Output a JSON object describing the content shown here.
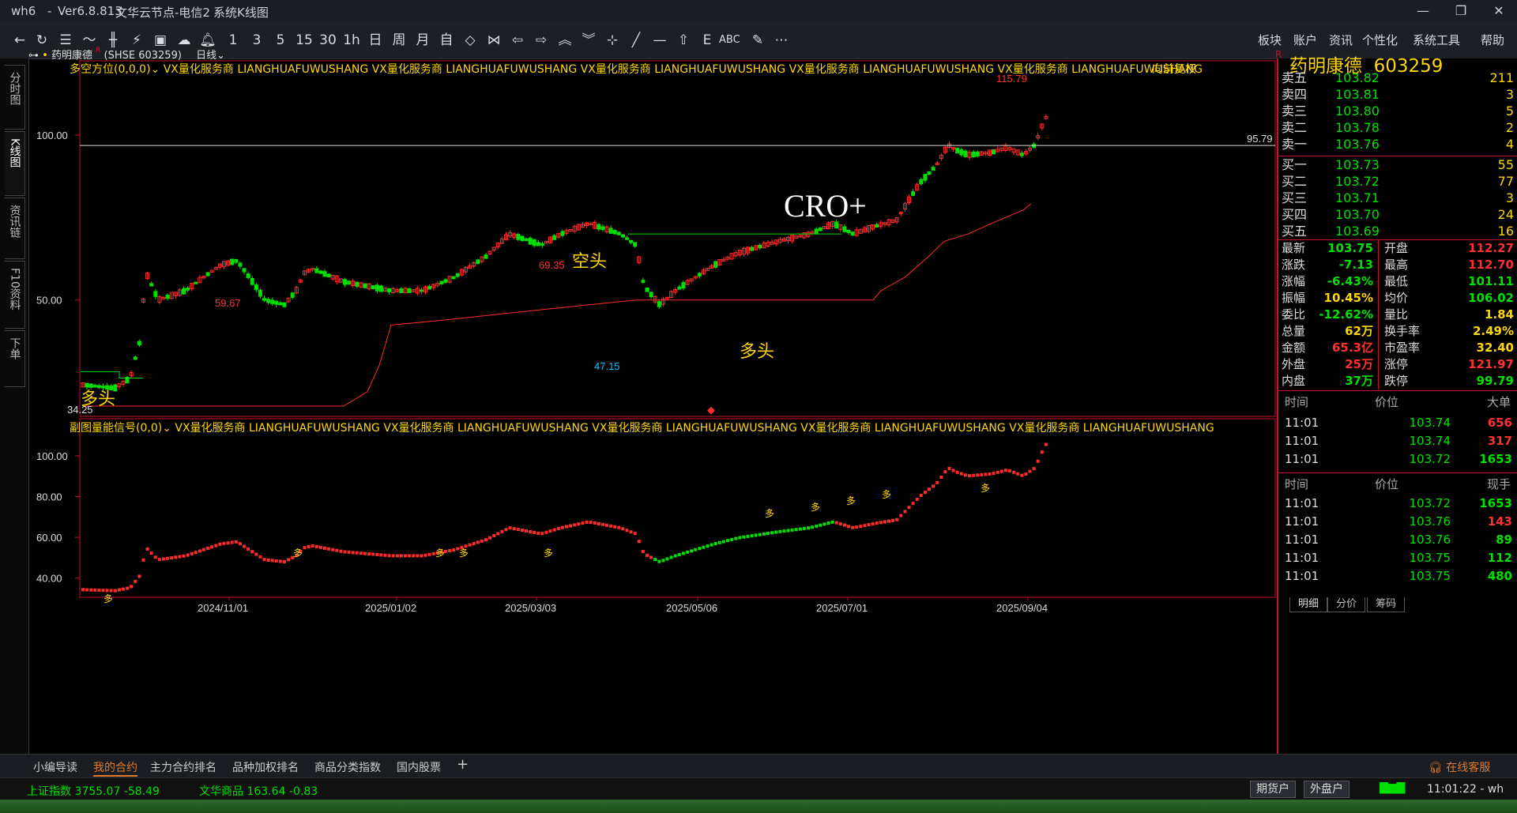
{
  "titlebar": {
    "app": "wh6",
    "version": "Ver6.8.813",
    "node": "文华云节点-电信2",
    "view": "系统K线图"
  },
  "menu_right": [
    "板块",
    "账户",
    "资讯",
    "个性化",
    "系统工具",
    "帮助"
  ],
  "toolbar_periods": [
    "1",
    "3",
    "5",
    "15",
    "30",
    "1h",
    "日",
    "周",
    "月",
    "自"
  ],
  "left_tabs": [
    "分时图",
    "K线图",
    "资讯链",
    "F10资料",
    "下单"
  ],
  "chart_header": {
    "symbol_name": "药明康德",
    "symbol_code": "(SHSE 603259)",
    "period": "日线",
    "main_indicator": "多空方位(0,0,0)",
    "main_ads": "VX量化服务商  LIANGHUAFUWUSHANG  VX量化服务商  LIANGHUAFUWUSHANG  VX量化服务商  LIANGHUAFUWUSHANG  VX量化服务商  LIANGHUAFUWUSHANG  VX量化服务商  LIANGHUAFUWUSHANG",
    "adjust": "向前复权",
    "sub_indicator": "副图量能信号(0,0)",
    "sub_ads": "VX量化服务商  LIANGHUAFUWUSHANG  VX量化服务商  LIANGHUAFUWUSHANG  VX量化服务商  LIANGHUAFUWUSHANG  VX量化服务商  LIANGHUAFUWUSHANG  VX量化服务商  LIANGHUAFUWUSHANG"
  },
  "annotations": {
    "high": "115.79",
    "ref_line": "95.79",
    "p1": "59.67",
    "p2": "69.35",
    "low": "47.15",
    "start": "34.25",
    "kongtou": "空头",
    "duotou1": "多头",
    "duotou2": "多头",
    "cro": "CRO+"
  },
  "axis": {
    "main_ticks": [
      "100.00",
      "50.00"
    ],
    "sub_ticks": [
      "100.00",
      "80.00",
      "60.00",
      "40.00"
    ],
    "dates": [
      "2024/11/01",
      "2025/01/02",
      "2025/03/03",
      "2025/05/06",
      "2025/07/01",
      "2025/09/04"
    ]
  },
  "colors": {
    "up": "#ff2a2a",
    "down": "#00e000",
    "accent": "#c8102e",
    "gold": "#ffd700"
  },
  "quote": {
    "name": "药明康德",
    "code": "603259",
    "asks": [
      {
        "label": "卖五",
        "price": "103.82",
        "vol": "211"
      },
      {
        "label": "卖四",
        "price": "103.81",
        "vol": "3"
      },
      {
        "label": "卖三",
        "price": "103.80",
        "vol": "5"
      },
      {
        "label": "卖二",
        "price": "103.78",
        "vol": "2"
      },
      {
        "label": "卖一",
        "price": "103.76",
        "vol": "4"
      }
    ],
    "bids": [
      {
        "label": "买一",
        "price": "103.73",
        "vol": "55"
      },
      {
        "label": "买二",
        "price": "103.72",
        "vol": "77"
      },
      {
        "label": "买三",
        "price": "103.71",
        "vol": "3"
      },
      {
        "label": "买四",
        "price": "103.70",
        "vol": "24"
      },
      {
        "label": "买五",
        "price": "103.69",
        "vol": "16"
      }
    ],
    "stats": [
      {
        "l1": "最新",
        "v1": "103.75",
        "c1": "g",
        "l2": "开盘",
        "v2": "112.27",
        "c2": "r"
      },
      {
        "l1": "涨跌",
        "v1": "-7.13",
        "c1": "g",
        "l2": "最高",
        "v2": "112.70",
        "c2": "r"
      },
      {
        "l1": "涨幅",
        "v1": "-6.43%",
        "c1": "g",
        "l2": "最低",
        "v2": "101.11",
        "c2": "g"
      },
      {
        "l1": "振幅",
        "v1": "10.45%",
        "c1": "y",
        "l2": "均价",
        "v2": "106.02",
        "c2": "g"
      },
      {
        "l1": "委比",
        "v1": "-12.62%",
        "c1": "g",
        "l2": "量比",
        "v2": "1.84",
        "c2": "y"
      },
      {
        "l1": "总量",
        "v1": "62万",
        "c1": "y",
        "l2": "换手率",
        "v2": "2.49%",
        "c2": "y"
      },
      {
        "l1": "金额",
        "v1": "65.3亿",
        "c1": "r",
        "l2": "市盈率",
        "v2": "32.40",
        "c2": "y"
      },
      {
        "l1": "外盘",
        "v1": "25万",
        "c1": "r",
        "l2": "涨停",
        "v2": "121.97",
        "c2": "r"
      },
      {
        "l1": "内盘",
        "v1": "37万",
        "c1": "g",
        "l2": "跌停",
        "v2": "99.79",
        "c2": "g"
      }
    ],
    "ticks1_header": {
      "time": "时间",
      "price": "价位",
      "vol": "大单"
    },
    "ticks1": [
      {
        "time": "11:01",
        "price": "103.74",
        "vol": "656",
        "c": "r"
      },
      {
        "time": "11:01",
        "price": "103.74",
        "vol": "317",
        "c": "r"
      },
      {
        "time": "11:01",
        "price": "103.72",
        "vol": "1653",
        "c": "g"
      }
    ],
    "ticks2_header": {
      "time": "时间",
      "price": "价位",
      "vol": "现手"
    },
    "ticks2": [
      {
        "time": "11:01",
        "price": "103.72",
        "vol": "1653",
        "c": "g"
      },
      {
        "time": "11:01",
        "price": "103.76",
        "vol": "143",
        "c": "r"
      },
      {
        "time": "11:01",
        "price": "103.76",
        "vol": "89",
        "c": "g"
      },
      {
        "time": "11:01",
        "price": "103.75",
        "vol": "112",
        "c": "g"
      },
      {
        "time": "11:01",
        "price": "103.75",
        "vol": "480",
        "c": "g"
      }
    ],
    "panel_tabs": [
      "明细",
      "分价",
      "筹码"
    ]
  },
  "bottom_tabs": [
    "小编导读",
    "我的合约",
    "主力合约排名",
    "品种加权排名",
    "商品分类指数",
    "国内股票",
    "+"
  ],
  "online_service": "在线客服",
  "status": {
    "idx1_name": "上证指数",
    "idx1_val": "3755.07",
    "idx1_chg": "-58.49",
    "idx2_name": "文华商品",
    "idx2_val": "163.64",
    "idx2_chg": "-0.83",
    "btn_futures": "期货户",
    "btn_outer": "外盘户",
    "clock": "11:01:22 - wh"
  }
}
